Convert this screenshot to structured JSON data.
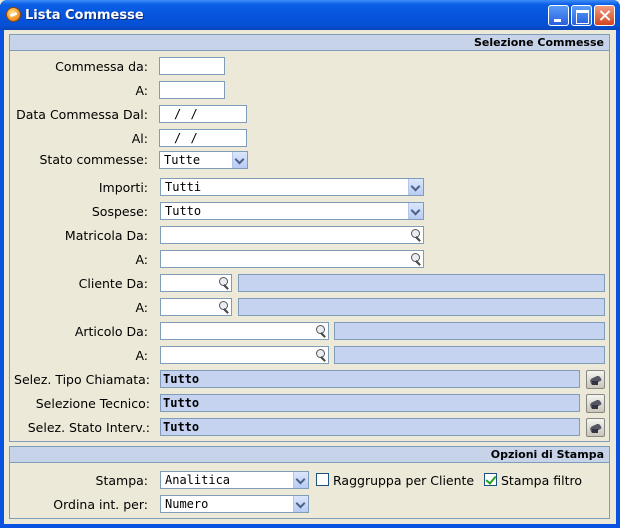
{
  "window": {
    "title": "Lista Commesse"
  },
  "selezione": {
    "header": "Selezione Commesse",
    "commessa_da": {
      "label": "Commessa da:",
      "value": ""
    },
    "commessa_a": {
      "label": "A:",
      "value": ""
    },
    "data_dal": {
      "label": "Data Commessa Dal:",
      "value": "/ /"
    },
    "data_al": {
      "label": "Al:",
      "value": "/ /"
    },
    "stato": {
      "label": "Stato commesse:",
      "value": "Tutte"
    },
    "importi": {
      "label": "Importi:",
      "value": "Tutti"
    },
    "sospese": {
      "label": "Sospese:",
      "value": "Tutto"
    },
    "matricola_da": {
      "label": "Matricola Da:",
      "value": ""
    },
    "matricola_a": {
      "label": "A:",
      "value": ""
    },
    "cliente_da": {
      "label": "Cliente Da:",
      "value": "",
      "desc": ""
    },
    "cliente_a": {
      "label": "A:",
      "value": "",
      "desc": ""
    },
    "articolo_da": {
      "label": "Articolo Da:",
      "value": "",
      "desc": ""
    },
    "articolo_a": {
      "label": "A:",
      "value": "",
      "desc": ""
    },
    "tipo_chiamata": {
      "label": "Selez. Tipo Chiamata:",
      "value": "Tutto"
    },
    "tecnico": {
      "label": "Selezione Tecnico:",
      "value": "Tutto"
    },
    "stato_interv": {
      "label": "Selez. Stato Interv.:",
      "value": "Tutto"
    }
  },
  "opzioni": {
    "header": "Opzioni di Stampa",
    "stampa": {
      "label": "Stampa:",
      "value": "Analitica"
    },
    "raggruppa": {
      "label": "Raggruppa per Cliente",
      "checked": false
    },
    "stampa_filtro": {
      "label": "Stampa filtro",
      "checked": true
    },
    "ordina": {
      "label": "Ordina int. per:",
      "value": "Numero"
    }
  }
}
